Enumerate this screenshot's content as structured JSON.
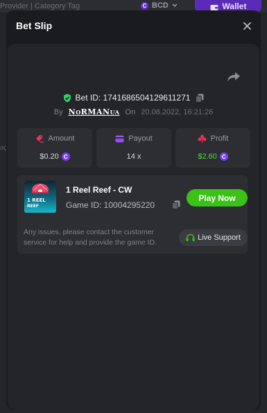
{
  "background": {
    "breadcrumb": "Provider | Category Tag",
    "currency": "BCD",
    "wallet_label": "Wallet",
    "side_text": "ag"
  },
  "modal": {
    "title": "Bet Slip"
  },
  "bet": {
    "bet_id_label": "Bet ID: 1741686504129611271",
    "by_label": "By",
    "username": "NoRMANua",
    "on_label": "On",
    "datetime": "20.08.2022, 16:21:26"
  },
  "stats": {
    "amount_label": "Amount",
    "amount_value": "$0.20",
    "payout_label": "Payout",
    "payout_value": "14 x",
    "profit_label": "Profit",
    "profit_value": "$2.60"
  },
  "game": {
    "title": "1 Reel Reef - CW",
    "game_id": "Game ID: 10004295220",
    "thumb_text": "1 REEL\nREEF",
    "play_label": "Play Now",
    "issues_text": "Any issues, please contact the customer service for help and provide the game ID.",
    "support_label": "Live Support"
  },
  "colors": {
    "accent_purple": "#7b3cf0",
    "play_green": "#3bc117",
    "profit_green": "#4fd93a",
    "shield_green": "#2fd16b"
  },
  "icons": {
    "coin": "C"
  }
}
